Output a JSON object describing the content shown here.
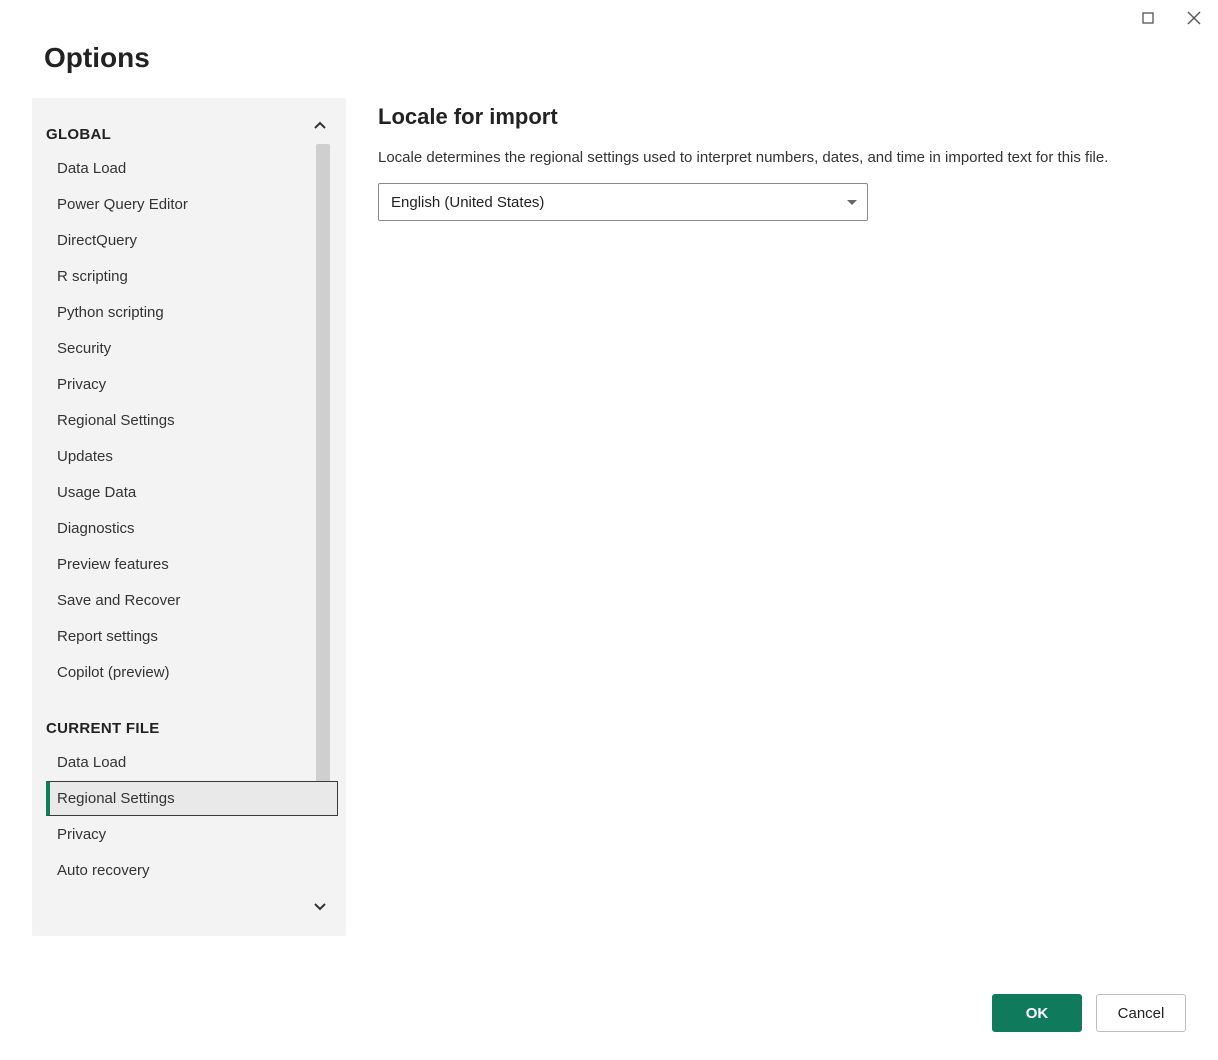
{
  "window": {
    "title": "Options"
  },
  "sidebar": {
    "sections": {
      "global": {
        "header": "GLOBAL",
        "items": [
          {
            "label": "Data Load"
          },
          {
            "label": "Power Query Editor"
          },
          {
            "label": "DirectQuery"
          },
          {
            "label": "R scripting"
          },
          {
            "label": "Python scripting"
          },
          {
            "label": "Security"
          },
          {
            "label": "Privacy"
          },
          {
            "label": "Regional Settings"
          },
          {
            "label": "Updates"
          },
          {
            "label": "Usage Data"
          },
          {
            "label": "Diagnostics"
          },
          {
            "label": "Preview features"
          },
          {
            "label": "Save and Recover"
          },
          {
            "label": "Report settings"
          },
          {
            "label": "Copilot (preview)"
          }
        ]
      },
      "current_file": {
        "header": "CURRENT FILE",
        "items": [
          {
            "label": "Data Load"
          },
          {
            "label": "Regional Settings",
            "selected": true
          },
          {
            "label": "Privacy"
          },
          {
            "label": "Auto recovery"
          }
        ]
      }
    }
  },
  "content": {
    "heading": "Locale for import",
    "description": "Locale determines the regional settings used to interpret numbers, dates, and time in imported text for this file.",
    "locale_selected": "English (United States)"
  },
  "footer": {
    "ok_label": "OK",
    "cancel_label": "Cancel"
  }
}
